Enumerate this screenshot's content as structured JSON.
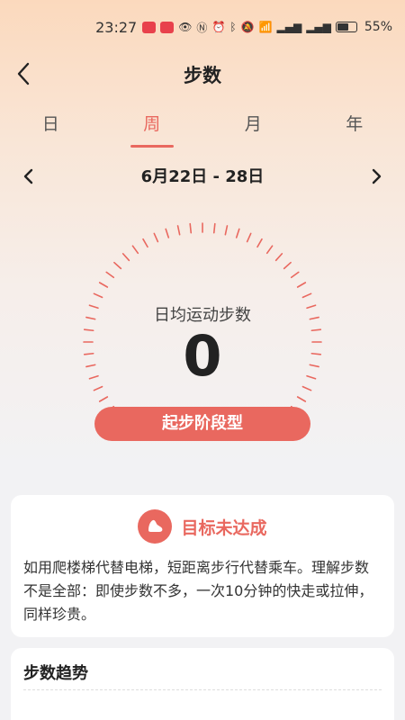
{
  "status_bar": {
    "time": "23:27",
    "battery_percent": "55%",
    "icons": [
      "app-badge-icon",
      "app-badge-icon",
      "eye-icon",
      "nfc-icon",
      "alarm-icon",
      "bluetooth-icon",
      "mute-icon",
      "wifi-icon",
      "signal-4g-icon",
      "signal-4g-icon",
      "battery-icon"
    ]
  },
  "header": {
    "title": "步数"
  },
  "period_tabs": [
    {
      "label": "日",
      "active": false
    },
    {
      "label": "周",
      "active": true
    },
    {
      "label": "月",
      "active": false
    },
    {
      "label": "年",
      "active": false
    }
  ],
  "date_range": {
    "label": "6月22日 - 28日"
  },
  "gauge": {
    "label": "日均运动步数",
    "value": "0",
    "stage": "起步阶段型"
  },
  "goal_card": {
    "title": "目标未达成",
    "description": "如用爬楼梯代替电梯，短距离步行代替乘车。理解步数不是全部：即使步数不多，一次10分钟的快走或拉伸，同样珍贵。"
  },
  "trend_card": {
    "title": "步数趋势"
  },
  "colors": {
    "accent": "#e9685f",
    "header_gradient_top": "#fbd9bd",
    "page_bg": "#f2f2f4"
  }
}
